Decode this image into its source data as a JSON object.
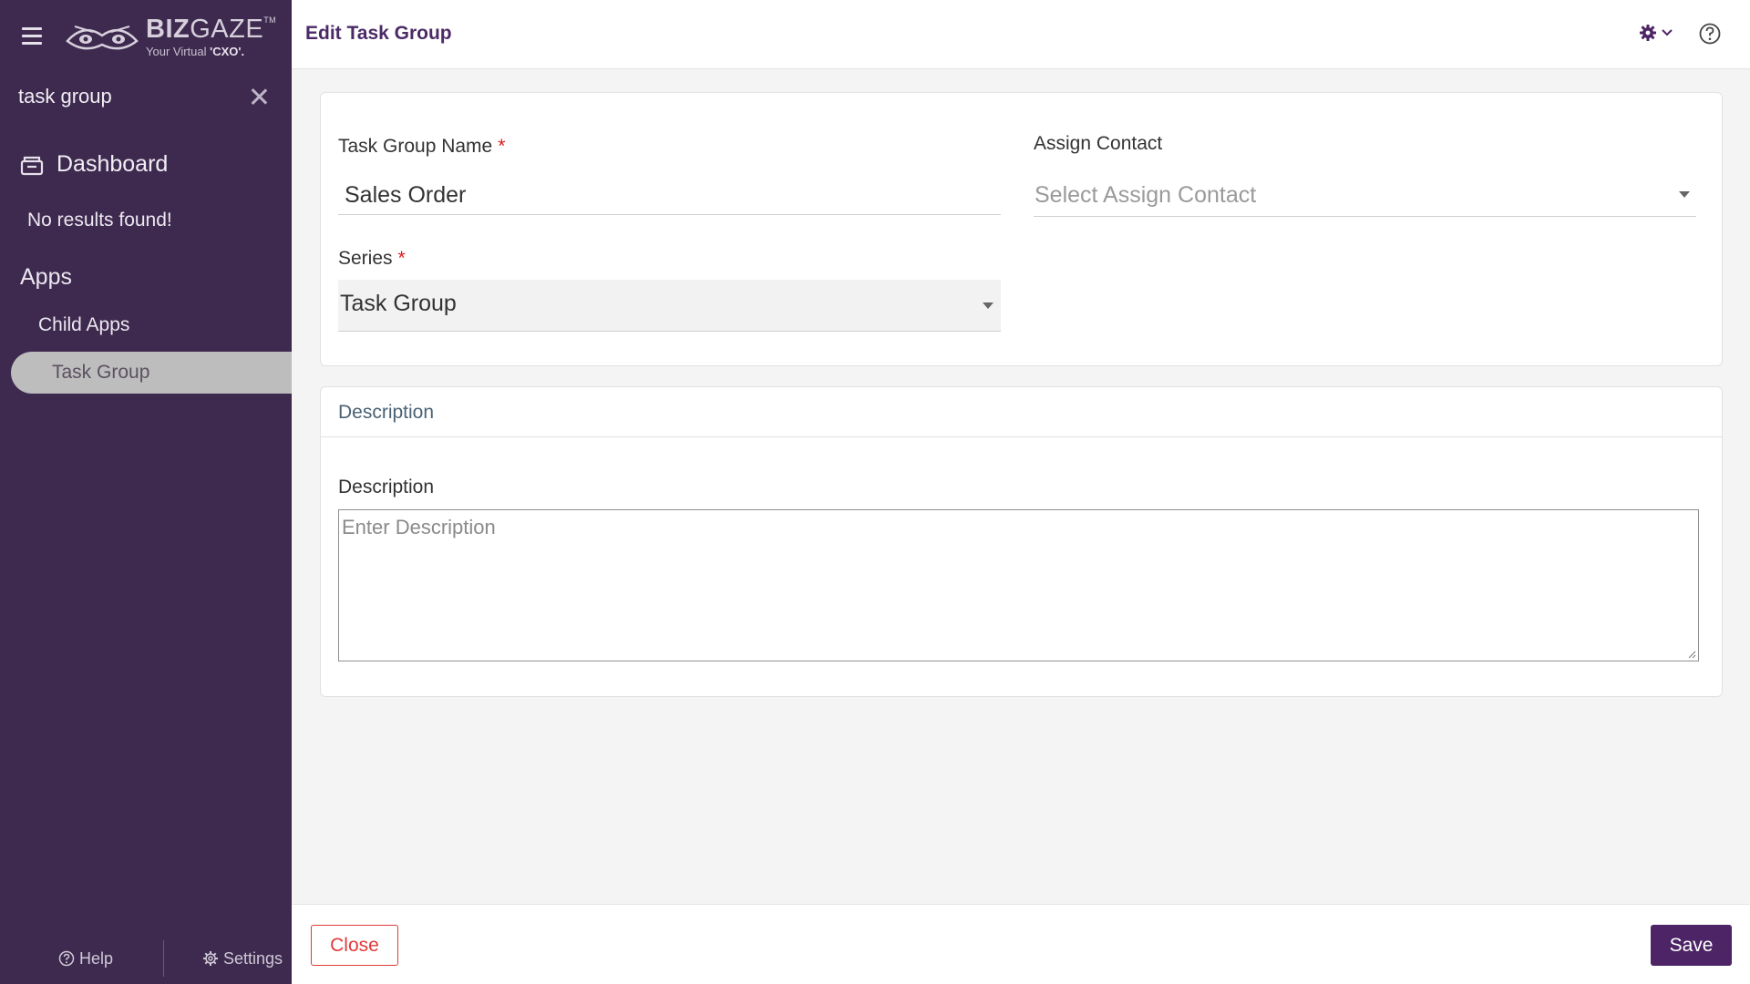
{
  "app": {
    "brand_bold": "BIZ",
    "brand_light": "GAZE",
    "brand_tm": "TM",
    "tagline_prefix": "Your Virtual ",
    "tagline_bold": "'CXO'."
  },
  "sidebar": {
    "search_value": "task group",
    "dashboard_label": "Dashboard",
    "no_results": "No results found!",
    "apps_title": "Apps",
    "child_apps": "Child Apps",
    "active_item": "Task Group",
    "footer": {
      "help_label": "Help",
      "settings_label": "Settings"
    }
  },
  "header": {
    "title": "Edit Task Group"
  },
  "form": {
    "task_group_name_label": "Task Group Name",
    "task_group_name_value": "Sales Order",
    "required_mark": "*",
    "assign_contact_label": "Assign Contact",
    "assign_contact_placeholder": "Select Assign Contact",
    "series_label": "Series",
    "series_value": "Task Group"
  },
  "description_section": {
    "header": "Description",
    "field_label": "Description",
    "placeholder": "Enter Description"
  },
  "footer": {
    "close_label": "Close",
    "save_label": "Save"
  },
  "colors": {
    "sidebar_bg": "#3e2a4f",
    "accent": "#4d2466",
    "title": "#4b2a66",
    "danger": "#e23a3a"
  }
}
